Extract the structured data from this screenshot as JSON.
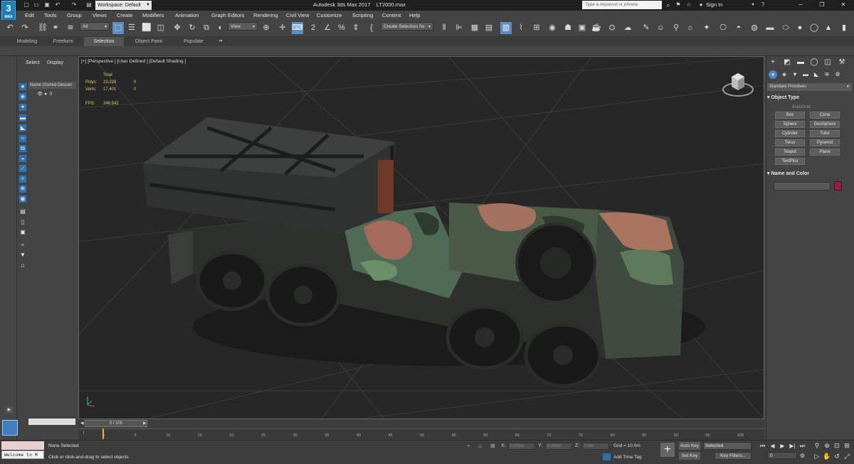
{
  "window": {
    "app_title": "Autodesk 3ds Max 2017",
    "file_name": "LT2000.max",
    "app_icon_top": "3",
    "app_icon_bottom": "MAX",
    "workspace": "Workspace: Default",
    "search_placeholder": "Type a keyword or phrase",
    "sign_in": "Sign In"
  },
  "menu": [
    "Edit",
    "Tools",
    "Group",
    "Views",
    "Create",
    "Modifiers",
    "Animation",
    "Graph Editors",
    "Rendering",
    "Civil View",
    "Customize",
    "Scripting",
    "Content",
    "Help"
  ],
  "toolbar": {
    "filter_value": "All",
    "refcoord_value": "View",
    "selection_set_value": "Create Selection Se"
  },
  "ribbon_tabs": [
    "Modeling",
    "Freeform",
    "Selection",
    "Object Paint",
    "Populate"
  ],
  "ribbon_active": "Selection",
  "scene_explorer": {
    "tabs": [
      "Select",
      "Display"
    ],
    "column_header": "Name (Sorted Descen",
    "row0": "0"
  },
  "viewport": {
    "label": "[+] [Perspective ] [User Defined ] [Default Shading ]",
    "stats": {
      "total_label": "Total",
      "polys_label": "Polys:",
      "polys_total": "23,226",
      "polys_sel": "0",
      "verts_label": "Verts:",
      "verts_total": "17,401",
      "verts_sel": "0",
      "fps_label": "FPS:",
      "fps_value": "246.542"
    }
  },
  "command_panel": {
    "primitives_dropdown": "Standard Primitives",
    "object_type_title": "Object Type",
    "autogrid": "AutoGrid",
    "buttons": [
      "Box",
      "Cone",
      "Sphere",
      "GeoSphere",
      "Cylinder",
      "Tube",
      "Torus",
      "Pyramid",
      "Teapot",
      "Plane",
      "TextPlus"
    ],
    "name_color_title": "Name and Color",
    "object_color": "#9b1b3b"
  },
  "timeline": {
    "slider_label": "0 / 100",
    "ticks": [
      "0",
      "5",
      "10",
      "15",
      "20",
      "25",
      "30",
      "35",
      "40",
      "45",
      "50",
      "55",
      "60",
      "65",
      "70",
      "75",
      "80",
      "85",
      "90",
      "95",
      "100"
    ]
  },
  "status": {
    "welcome": "Welcome to M",
    "selection": "None Selected",
    "prompt": "Click or click-and-drag to select objects",
    "x_label": "X:",
    "x_value": "0.935m",
    "y_label": "Y:",
    "y_value": "6.356m",
    "z_label": "Z:",
    "z_value": "0.0m",
    "grid": "Grid = 10.0m",
    "add_time_tag": "Add Time Tag",
    "auto_key": "Auto Key",
    "set_key": "Set Key",
    "selected_dropdown": "Selected",
    "key_filters": "Key Filters...",
    "frame": "0"
  }
}
